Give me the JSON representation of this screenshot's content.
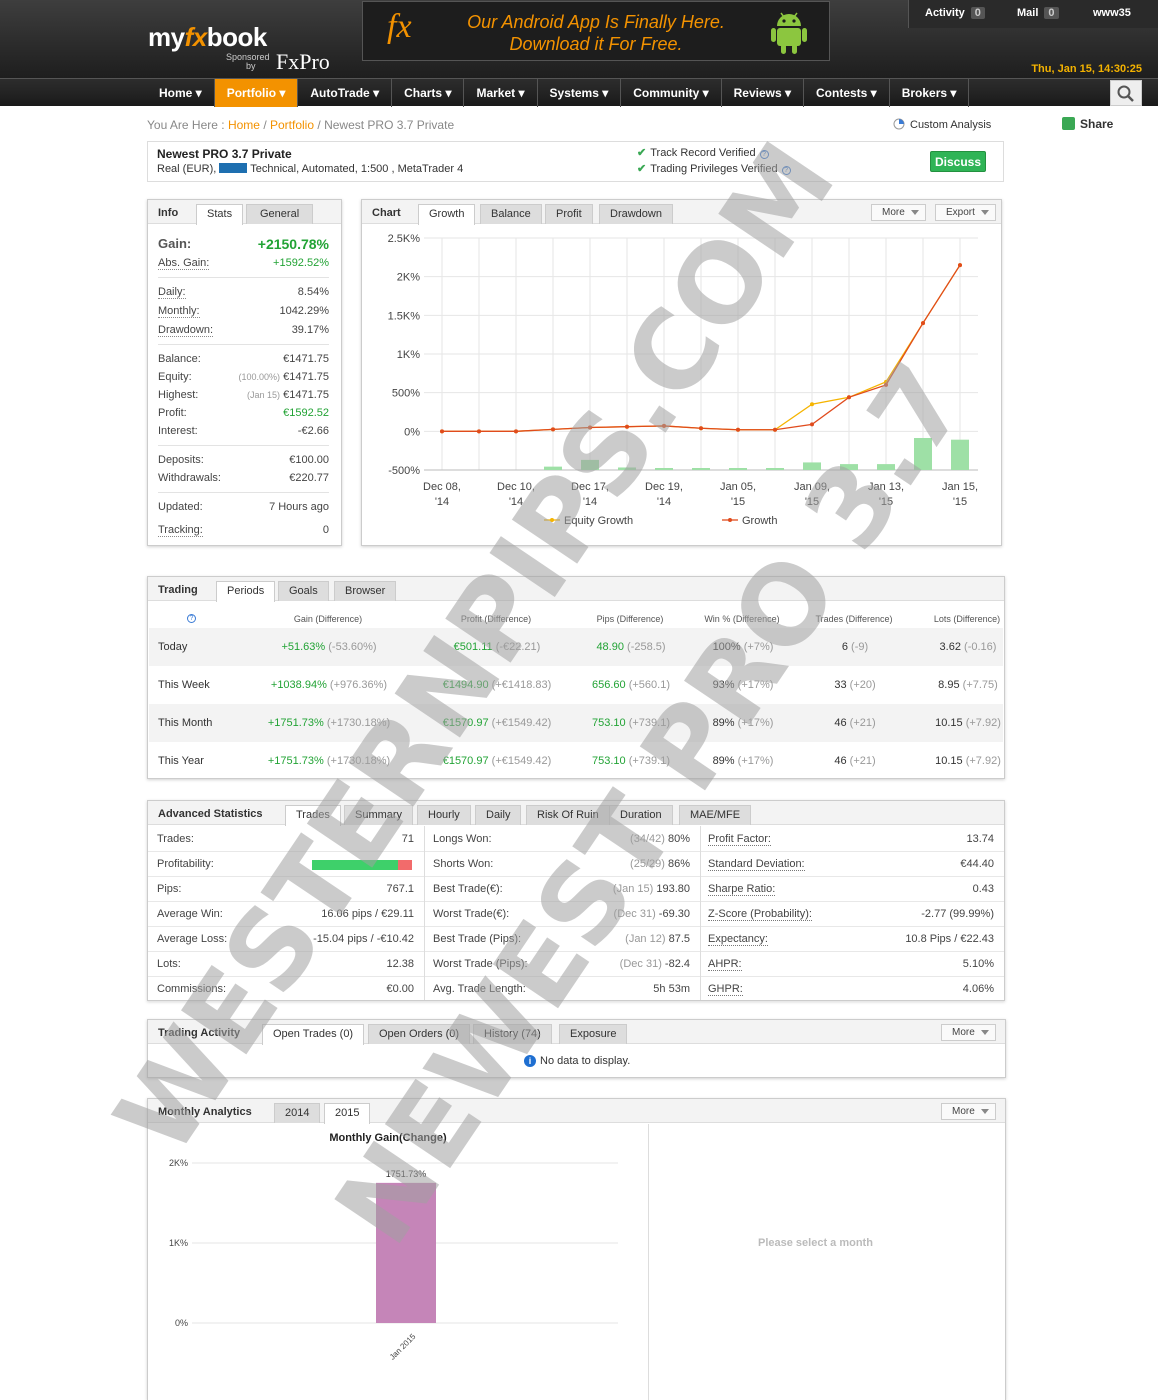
{
  "header": {
    "logo_text": "my",
    "logo_fx": "fx",
    "logo_book": "book",
    "sponsored": "Sponsored",
    "by": "by",
    "fxpro": "FxPro",
    "banner_fx": "fx",
    "banner_line1": "Our Android App Is Finally Here.",
    "banner_line2": "Download it For Free.",
    "activity_label": "Activity",
    "activity_count": "0",
    "mail_label": "Mail",
    "mail_count": "0",
    "username": "www35",
    "datetime": "Thu, Jan 15, 14:30:25"
  },
  "nav": [
    {
      "label": "Home ▾"
    },
    {
      "label": "Portfolio ▾"
    },
    {
      "label": "AutoTrade ▾"
    },
    {
      "label": "Charts ▾"
    },
    {
      "label": "Market ▾"
    },
    {
      "label": "Systems ▾"
    },
    {
      "label": "Community ▾"
    },
    {
      "label": "Reviews ▾"
    },
    {
      "label": "Contests ▾"
    },
    {
      "label": "Brokers ▾"
    }
  ],
  "breadcrumb": {
    "prefix": "You Are Here :",
    "home": "Home",
    "portfolio": "Portfolio",
    "current": "Newest PRO 3.7 Private",
    "sep": "/"
  },
  "custom_analysis": "Custom Analysis",
  "share": "Share",
  "account": {
    "title": "Newest PRO 3.7 Private",
    "sub_pre": "Real (EUR),",
    "sub_post": "Technical, Automated, 1:500 , MetaTrader 4",
    "verified1": "Track Record Verified",
    "verified2": "Trading Privileges Verified",
    "discuss": "Discuss"
  },
  "info": {
    "title": "Info",
    "tabs": [
      "Stats",
      "General"
    ],
    "gain_label": "Gain:",
    "gain_value": "+2150.78%",
    "abs_gain_label": "Abs. Gain:",
    "abs_gain_value": "+1592.52%",
    "daily_label": "Daily:",
    "daily_value": "8.54%",
    "monthly_label": "Monthly:",
    "monthly_value": "1042.29%",
    "drawdown_label": "Drawdown:",
    "drawdown_value": "39.17%",
    "balance_label": "Balance:",
    "balance_value": "€1471.75",
    "equity_label": "Equity:",
    "equity_pct": "(100.00%)",
    "equity_value": "€1471.75",
    "highest_label": "Highest:",
    "highest_date": "(Jan 15)",
    "highest_value": "€1471.75",
    "profit_label": "Profit:",
    "profit_value": "€1592.52",
    "interest_label": "Interest:",
    "interest_value": "-€2.66",
    "deposits_label": "Deposits:",
    "deposits_value": "€100.00",
    "withdrawals_label": "Withdrawals:",
    "withdrawals_value": "€220.77",
    "updated_label": "Updated:",
    "updated_value": "7 Hours ago",
    "tracking_label": "Tracking:",
    "tracking_value": "0"
  },
  "chart_panel": {
    "title": "Chart",
    "tabs": [
      "Growth",
      "Balance",
      "Profit",
      "Drawdown"
    ],
    "more": "More",
    "export": "Export"
  },
  "chart_data": [
    {
      "type": "line",
      "title": "",
      "x": [
        "Dec 08, '14",
        "Dec 10, '14",
        "Dec 17, '14",
        "Dec 19, '14",
        "Jan 05, '15",
        "Jan 09, '15",
        "Jan 13, '15",
        "Jan 15, '15"
      ],
      "y_tick_labels": [
        "-500%",
        "0%",
        "500%",
        "1K%",
        "1.5K%",
        "2K%",
        "2.5K%"
      ],
      "ylim": [
        -500,
        2500
      ],
      "grid": true,
      "legend": "bottom",
      "series": [
        {
          "name": "Equity Growth",
          "color": "#f5b400",
          "values": [
            0,
            0,
            0,
            25,
            50,
            60,
            70,
            40,
            20,
            20,
            350,
            440,
            640,
            1400,
            2150
          ]
        },
        {
          "name": "Growth",
          "color": "#e04b1d",
          "values": [
            0,
            0,
            0,
            25,
            50,
            60,
            70,
            40,
            20,
            20,
            90,
            440,
            600,
            1400,
            2150
          ]
        }
      ],
      "bar_values": [
        0,
        0,
        0,
        40,
        120,
        30,
        15,
        10,
        12,
        10,
        90,
        70,
        70,
        380,
        360
      ]
    },
    {
      "type": "bar",
      "title": "Monthly Gain(Change)",
      "categories": [
        "Jan 2015"
      ],
      "values": [
        1751.73
      ],
      "value_labels": [
        "1751.73%"
      ],
      "y_tick_labels": [
        "0%",
        "1K%",
        "2K%"
      ],
      "ylim": [
        0,
        2000
      ],
      "color": "#c585b8"
    }
  ],
  "trading": {
    "title": "Trading",
    "tabs": [
      "Periods",
      "Goals",
      "Browser"
    ],
    "help": "?",
    "headers": [
      "Gain (Difference)",
      "Profit (Difference)",
      "Pips (Difference)",
      "Win % (Difference)",
      "Trades (Difference)",
      "Lots (Difference)"
    ],
    "rows": [
      {
        "period": "Today",
        "gain": "+51.63%",
        "gain_d": "(-53.60%)",
        "profit": "€501.11",
        "profit_d": "(-€22.21)",
        "pips": "48.90",
        "pips_d": "(-258.5)",
        "win": "100%",
        "win_d": "(+7%)",
        "trades": "6",
        "trades_d": "(-9)",
        "lots": "3.62",
        "lots_d": "(-0.16)"
      },
      {
        "period": "This Week",
        "gain": "+1038.94%",
        "gain_d": "(+976.36%)",
        "profit": "€1494.90",
        "profit_d": "(+€1418.83)",
        "pips": "656.60",
        "pips_d": "(+560.1)",
        "win": "93%",
        "win_d": "(+17%)",
        "trades": "33",
        "trades_d": "(+20)",
        "lots": "8.95",
        "lots_d": "(+7.75)"
      },
      {
        "period": "This Month",
        "gain": "+1751.73%",
        "gain_d": "(+1730.18%)",
        "profit": "€1570.97",
        "profit_d": "(+€1549.42)",
        "pips": "753.10",
        "pips_d": "(+739.1)",
        "win": "89%",
        "win_d": "(+17%)",
        "trades": "46",
        "trades_d": "(+21)",
        "lots": "10.15",
        "lots_d": "(+7.92)"
      },
      {
        "period": "This Year",
        "gain": "+1751.73%",
        "gain_d": "(+1730.18%)",
        "profit": "€1570.97",
        "profit_d": "(+€1549.42)",
        "pips": "753.10",
        "pips_d": "(+739.1)",
        "win": "89%",
        "win_d": "(+17%)",
        "trades": "46",
        "trades_d": "(+21)",
        "lots": "10.15",
        "lots_d": "(+7.92)"
      }
    ]
  },
  "advanced": {
    "title": "Advanced Statistics",
    "tabs": [
      "Trades",
      "Summary",
      "Hourly",
      "Daily",
      "Risk Of Ruin",
      "Duration",
      "MAE/MFE"
    ],
    "col1": [
      {
        "k": "Trades:",
        "v": "71"
      },
      {
        "k": "Profitability:",
        "v": ""
      },
      {
        "k": "Pips:",
        "v": "767.1"
      },
      {
        "k": "Average Win:",
        "v": "16.06 pips / €29.11"
      },
      {
        "k": "Average Loss:",
        "v": "-15.04 pips / -€10.42"
      },
      {
        "k": "Lots:",
        "v": "12.38"
      },
      {
        "k": "Commissions:",
        "v": "€0.00"
      }
    ],
    "profitability_win_fraction": 0.86,
    "col2": [
      {
        "k": "Longs Won:",
        "p": "(34/42)",
        "v": "80%"
      },
      {
        "k": "Shorts Won:",
        "p": "(25/29)",
        "v": "86%"
      },
      {
        "k": "Best Trade(€):",
        "p": "(Jan 15)",
        "v": "193.80"
      },
      {
        "k": "Worst Trade(€):",
        "p": "(Dec 31)",
        "v": "-69.30"
      },
      {
        "k": "Best Trade (Pips):",
        "p": "(Jan 12)",
        "v": "87.5"
      },
      {
        "k": "Worst Trade (Pips):",
        "p": "(Dec 31)",
        "v": "-82.4"
      },
      {
        "k": "Avg. Trade Length:",
        "p": "",
        "v": "5h 53m"
      }
    ],
    "col3": [
      {
        "k": "Profit Factor:",
        "v": "13.74"
      },
      {
        "k": "Standard Deviation:",
        "v": "€44.40"
      },
      {
        "k": "Sharpe Ratio:",
        "v": "0.43"
      },
      {
        "k": "Z-Score (Probability):",
        "v": "-2.77 (99.99%)"
      },
      {
        "k": "Expectancy:",
        "v": "10.8 Pips / €22.43"
      },
      {
        "k": "AHPR:",
        "v": "5.10%"
      },
      {
        "k": "GHPR:",
        "v": "4.06%"
      }
    ]
  },
  "activity": {
    "title": "Trading Activity",
    "tabs": [
      "Open Trades (0)",
      "Open Orders (0)",
      "History (74)",
      "Exposure"
    ],
    "more": "More",
    "nodata": "No data to display."
  },
  "monthly": {
    "title": "Monthly Analytics",
    "tabs": [
      "2014",
      "2015"
    ],
    "more": "More",
    "select_msg": "Please select a month"
  },
  "watermark": {
    "line1": "WESTERNPIPS.COM",
    "line2": "NEWEST PRO 3.7"
  }
}
